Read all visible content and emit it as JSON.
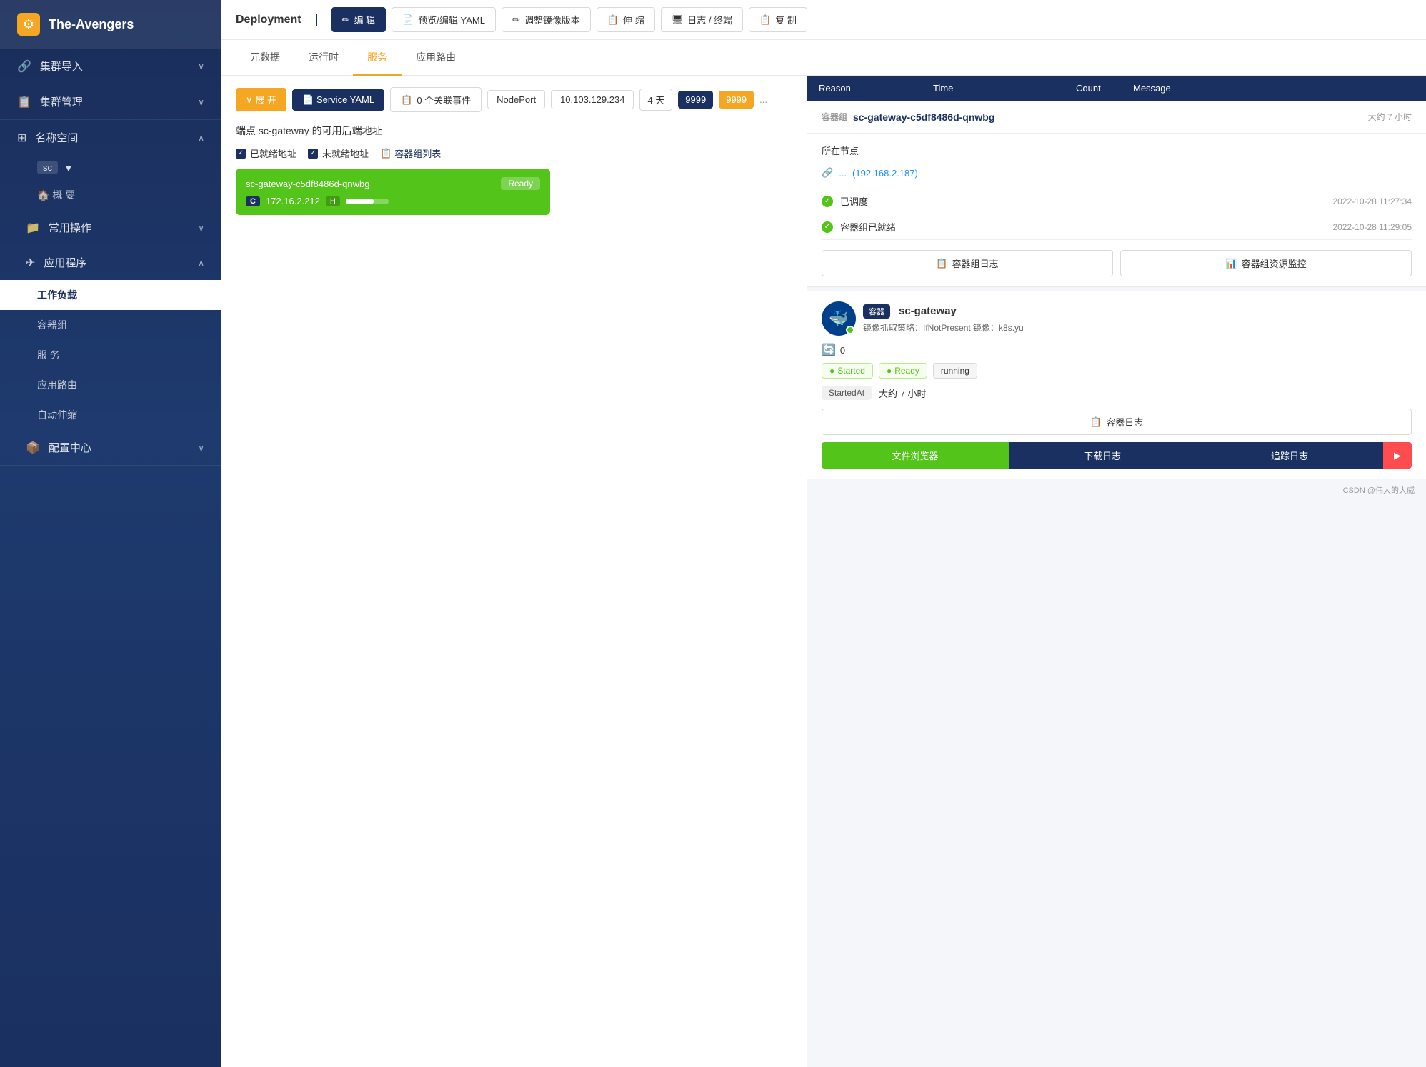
{
  "sidebar": {
    "logo": "The-Avengers",
    "logo_icon": "⚙",
    "items": [
      {
        "id": "cluster-import",
        "label": "集群导入",
        "icon": "🔗",
        "expanded": false
      },
      {
        "id": "cluster-manage",
        "label": "集群管理",
        "icon": "📋",
        "expanded": false
      },
      {
        "id": "namespace",
        "label": "名称空间",
        "icon": "⊞",
        "expanded": true
      },
      {
        "id": "overview",
        "label": "概 要",
        "icon": "🏠",
        "sub": true
      },
      {
        "id": "common-ops",
        "label": "常用操作",
        "icon": "📁",
        "expanded": false,
        "sub": true
      },
      {
        "id": "app",
        "label": "应用程序",
        "icon": "✈",
        "expanded": true,
        "sub": true
      },
      {
        "id": "workload",
        "label": "工作负载",
        "active": true,
        "subsub": true
      },
      {
        "id": "container-group",
        "label": "容器组",
        "subsub": true
      },
      {
        "id": "service",
        "label": "服 务",
        "subsub": true
      },
      {
        "id": "app-route",
        "label": "应用路由",
        "subsub": true
      },
      {
        "id": "auto-scale",
        "label": "自动伸缩",
        "subsub": true
      },
      {
        "id": "config-center",
        "label": "配置中心",
        "icon": "📦",
        "expanded": false,
        "sub": true
      }
    ],
    "namespace": "sc"
  },
  "topbar": {
    "title": "Deployment",
    "buttons": [
      {
        "id": "edit",
        "label": "编 辑",
        "icon": "✏",
        "primary": true
      },
      {
        "id": "preview-yaml",
        "label": "预览/编辑 YAML",
        "icon": "📄"
      },
      {
        "id": "adjust-image",
        "label": "调整镜像版本",
        "icon": "✏"
      },
      {
        "id": "scale",
        "label": "伸 缩",
        "icon": "📋"
      },
      {
        "id": "logs",
        "label": "日志 / 终端",
        "icon": "🖥"
      },
      {
        "id": "replicate",
        "label": "复 制",
        "icon": "📋"
      }
    ]
  },
  "tabs": [
    {
      "id": "metadata",
      "label": "元数据"
    },
    {
      "id": "runtime",
      "label": "运行时"
    },
    {
      "id": "service",
      "label": "服务",
      "active": true
    },
    {
      "id": "app-route",
      "label": "应用路由"
    }
  ],
  "service_toolbar": {
    "expand_label": "展 开",
    "yaml_label": "Service YAML",
    "events_label": "0 个关联事件",
    "nodeport_label": "NodePort",
    "ip": "10.103.129.234",
    "days": "4 天",
    "port1": "9999",
    "port2": "9999"
  },
  "endpoint": {
    "title": "端点 sc-gateway 的可用后端地址",
    "filter_ready": "已就绪地址",
    "filter_notready": "未就绪地址",
    "container_list": "容器组列表",
    "pod_name": "sc-gateway-c5df8486d-qnwbg",
    "pod_status": "Ready",
    "pod_ip": "172.16.2.212",
    "pod_c": "C",
    "pod_h": "H",
    "progress_pct": 65
  },
  "container_group": {
    "label": "容器组",
    "name": "sc-gateway-c5df8486d-qnwbg",
    "time": "大约 7 小时",
    "node_section": "所在节点",
    "node_link": "...",
    "node_ip": "(192.168.2.187)",
    "events": [
      {
        "id": "scheduled",
        "label": "已调度",
        "time": "2022-10-28 11:27:34"
      },
      {
        "id": "ready",
        "label": "容器组已就绪",
        "time": "2022-10-28 11:29:05"
      }
    ],
    "btn_log": "容器组日志",
    "btn_monitor": "容器组资源监控"
  },
  "container": {
    "badge": "容器",
    "name": "sc-gateway",
    "image_policy": "镜像抓取策略：IfNotPresent",
    "image": "镜像：k8s.yu",
    "restart_count": "0",
    "status_started": "Started",
    "status_ready": "Ready",
    "status_running": "running",
    "started_at_label": "StartedAt",
    "started_at_value": "大约 7 小时",
    "btn_log": "容器日志",
    "btn_file": "文件浏览器",
    "btn_download": "下载日志",
    "btn_trace": "追踪日志"
  },
  "events_table": {
    "headers": [
      "Reason",
      "Time",
      "Count",
      "Message"
    ]
  },
  "footer": {
    "credit": "CSDN @伟大的大威"
  },
  "colors": {
    "sidebar_bg": "#1a2d5a",
    "primary": "#1a3060",
    "orange": "#f5a623",
    "green": "#52c41a",
    "red": "#ff4d4f"
  }
}
